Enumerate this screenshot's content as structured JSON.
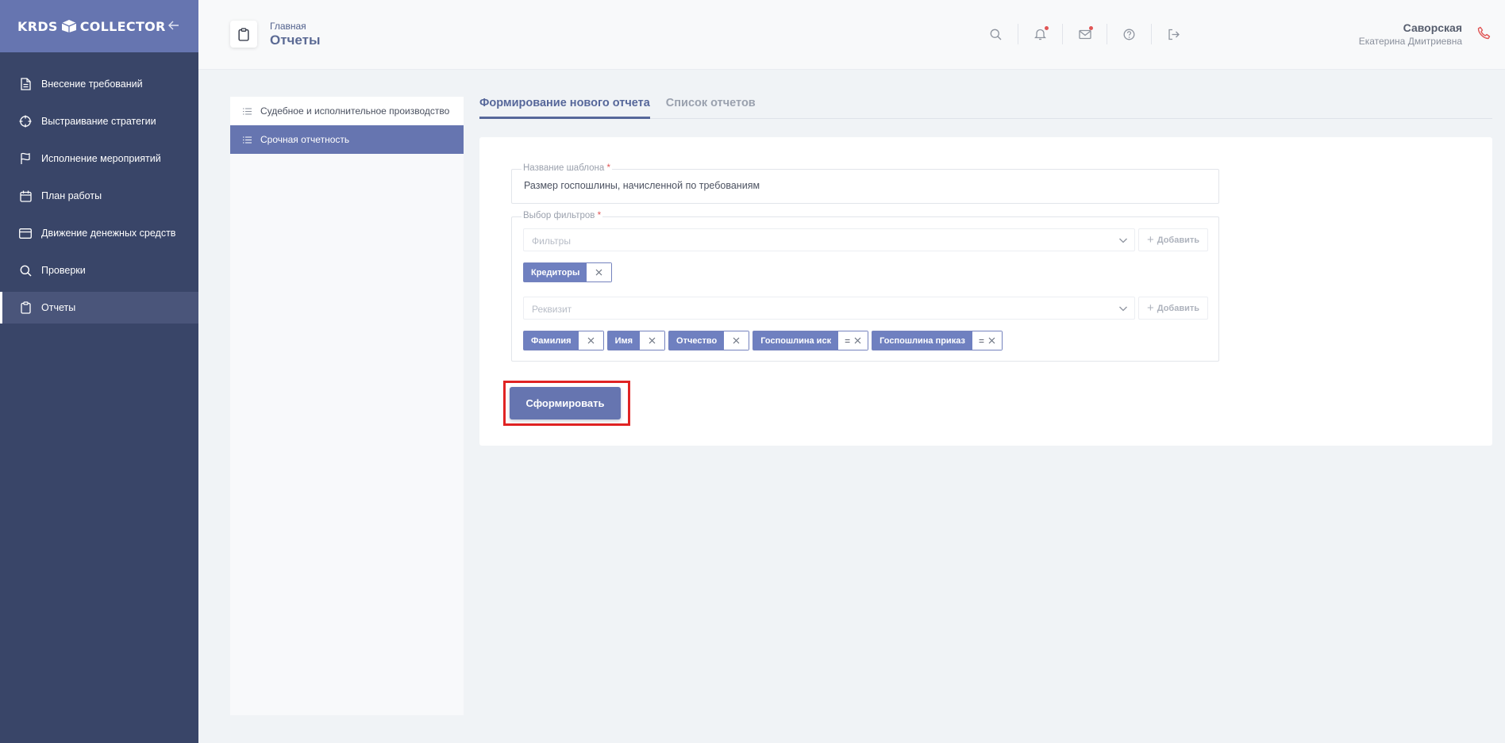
{
  "app": {
    "logo_left": "KRDS",
    "logo_right": "COLLECTOR"
  },
  "sidebar": {
    "items": [
      {
        "label": "Внесение требований",
        "icon": "document-icon"
      },
      {
        "label": "Выстраивание стратегии",
        "icon": "crosshair-icon"
      },
      {
        "label": "Исполнение мероприятий",
        "icon": "flag-icon"
      },
      {
        "label": "План работы",
        "icon": "calendar-icon"
      },
      {
        "label": "Движение денежных средств",
        "icon": "credit-card-icon"
      },
      {
        "label": "Проверки",
        "icon": "search-icon"
      },
      {
        "label": "Отчеты",
        "icon": "clipboard-icon",
        "active": true
      }
    ]
  },
  "header": {
    "breadcrumb": "Главная",
    "title": "Отчеты",
    "user": {
      "surname": "Саворская",
      "name": "Екатерина Дмитриевна"
    }
  },
  "reports": {
    "items": [
      {
        "label": "Судебное и исполнительное производство"
      },
      {
        "label": "Срочная отчетность",
        "active": true
      }
    ]
  },
  "tabs": [
    {
      "label": "Формирование нового отчета",
      "active": true
    },
    {
      "label": "Список отчетов"
    }
  ],
  "form": {
    "template_name_label": "Название шаблона",
    "template_name_value": "Размер госпошлины, начисленной по требованиям",
    "filters_label": "Выбор фильтров",
    "required_mark": "*",
    "filters_placeholder": "Фильтры",
    "add_label": "Добавить",
    "filter_chips": [
      {
        "label": "Кредиторы"
      }
    ],
    "requisite_placeholder": "Реквизит",
    "requisite_chips": [
      {
        "label": "Фамилия",
        "eq": ""
      },
      {
        "label": "Имя",
        "eq": ""
      },
      {
        "label": "Отчество",
        "eq": ""
      },
      {
        "label": "Госпошлина иск",
        "eq": "="
      },
      {
        "label": "Госпошлина приказ",
        "eq": "="
      }
    ],
    "submit_label": "Сформировать"
  },
  "colors": {
    "sidebar_bg": "#394568",
    "accent": "#6675b0",
    "highlight": "#e02323"
  }
}
